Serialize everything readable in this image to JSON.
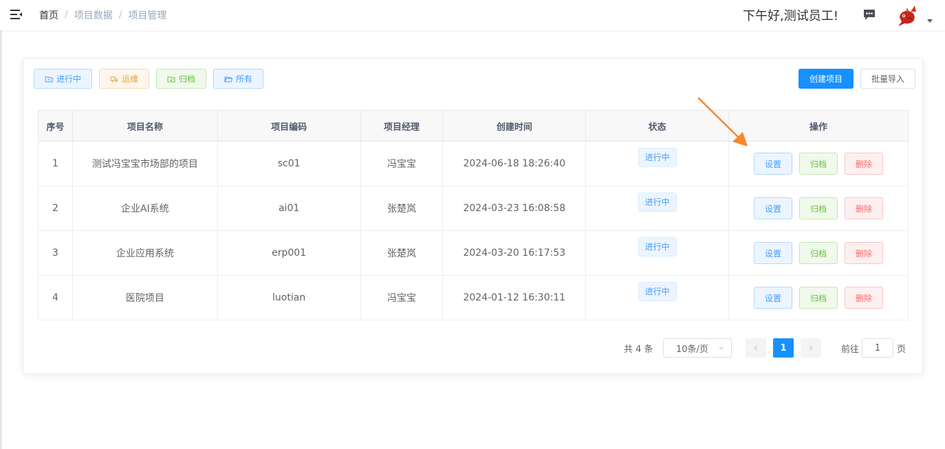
{
  "navbar": {
    "menu_icon": "hamburger-icon",
    "breadcrumb": [
      "首页",
      "项目数据",
      "项目管理"
    ],
    "separator": "/",
    "greeting": "下午好,测试员工!",
    "message_icon": "chat-icon",
    "avatar_icon": "fish-avatar"
  },
  "filters": [
    {
      "label": "进行中",
      "icon": "folder-icon"
    },
    {
      "label": "运维",
      "icon": "truck-icon"
    },
    {
      "label": "归档",
      "icon": "folder-check-icon"
    },
    {
      "label": "所有",
      "icon": "folder-open-icon"
    }
  ],
  "actions": {
    "create": "创建项目",
    "import": "批量导入"
  },
  "table": {
    "headers": [
      "序号",
      "项目名称",
      "项目编码",
      "项目经理",
      "创建时间",
      "状态",
      "操作"
    ],
    "rows": [
      {
        "index": "1",
        "name": "测试冯宝宝市场部的项目",
        "code": "sc01",
        "manager": "冯宝宝",
        "created": "2024-06-18 18:26:40",
        "status": "进行中"
      },
      {
        "index": "2",
        "name": "企业AI系统",
        "code": "ai01",
        "manager": "张楚岚",
        "created": "2024-03-23 16:08:58",
        "status": "进行中"
      },
      {
        "index": "3",
        "name": "企业应用系统",
        "code": "erp001",
        "manager": "张楚岚",
        "created": "2024-03-20 16:17:53",
        "status": "进行中"
      },
      {
        "index": "4",
        "name": "医院项目",
        "code": "luotian",
        "manager": "冯宝宝",
        "created": "2024-01-12 16:30:11",
        "status": "进行中"
      }
    ],
    "row_actions": {
      "settings": "设置",
      "archive": "归档",
      "delete": "删除"
    }
  },
  "pagination": {
    "total": "共 4 条",
    "page_size": "10条/页",
    "current_page": "1",
    "goto_label": "前往",
    "goto_value": "1",
    "page_unit": "页"
  },
  "colors": {
    "primary": "#1890ff",
    "info": "#409eff",
    "warning": "#e6a23c",
    "success": "#67c23a",
    "danger": "#f56c6c",
    "annotation_arrow": "#f5872e"
  }
}
